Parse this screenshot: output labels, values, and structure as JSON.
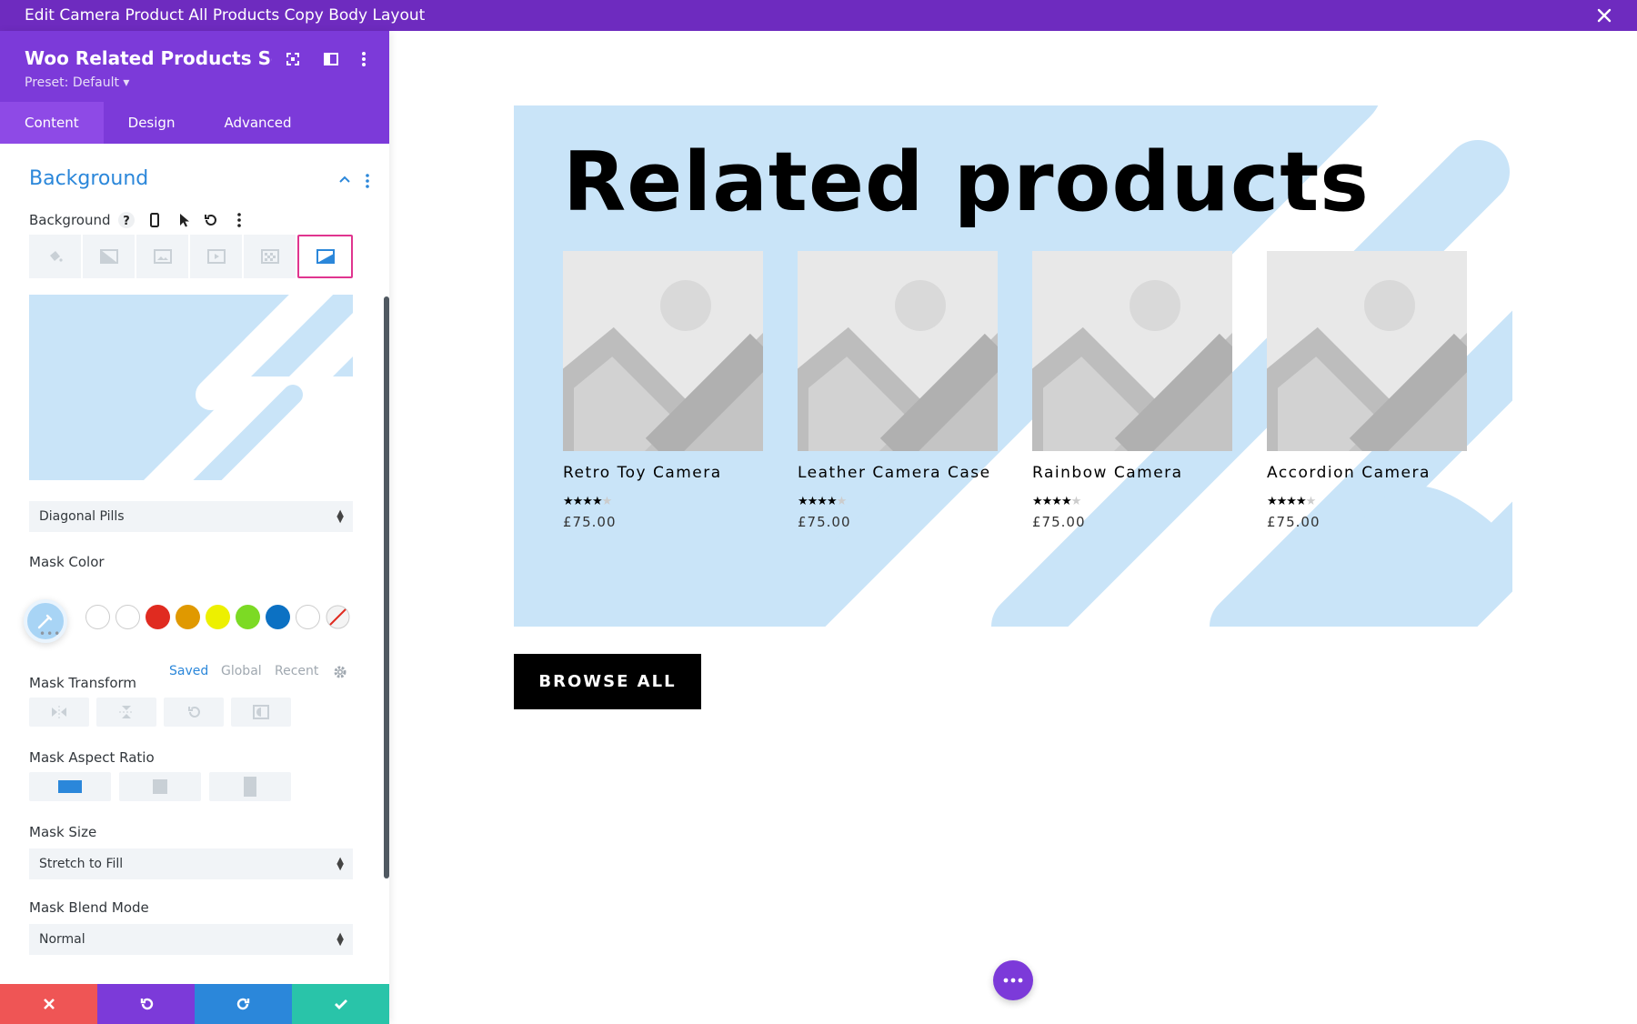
{
  "window": {
    "title": "Edit Camera Product All Products Copy Body Layout"
  },
  "panel": {
    "title": "Woo Related Products Setti...",
    "preset": "Preset: Default ▾",
    "tabs": [
      {
        "label": "Content"
      },
      {
        "label": "Design"
      },
      {
        "label": "Advanced"
      }
    ],
    "section_title": "Background",
    "background_label": "Background",
    "background_tabs": [
      "paint-bucket-icon",
      "gradient-icon",
      "image-icon",
      "video-icon",
      "pattern-icon",
      "mask-icon"
    ],
    "active_background_tab": "mask-icon",
    "mask_style": {
      "value": "Diagonal Pills"
    },
    "mask_color": {
      "label": "Mask Color",
      "swatches": [
        "#ffffff",
        "#ffffff",
        "#e02b20",
        "#e09900",
        "#edf000",
        "#7cda24",
        "#0c71c3",
        "#ffffff"
      ],
      "tabs": [
        "Saved",
        "Global",
        "Recent"
      ],
      "active_tab": "Saved",
      "more_label": "•••"
    },
    "mask_transform": {
      "label": "Mask Transform"
    },
    "mask_aspect_ratio": {
      "label": "Mask Aspect Ratio"
    },
    "mask_size": {
      "label": "Mask Size",
      "value": "Stretch to Fill"
    },
    "mask_blend_mode": {
      "label": "Mask Blend Mode",
      "value": "Normal"
    }
  },
  "canvas": {
    "heading": "Related products",
    "products": [
      {
        "name": "Retro Toy Camera",
        "price": "£75.00",
        "rating": 4
      },
      {
        "name": "Leather Camera Case",
        "price": "£75.00",
        "rating": 4
      },
      {
        "name": "Rainbow Camera",
        "price": "£75.00",
        "rating": 4
      },
      {
        "name": "Accordion Camera",
        "price": "£75.00",
        "rating": 4
      }
    ],
    "button_label": "BROWSE ALL"
  },
  "colors": {
    "topbar": "#6e2bbf",
    "panel_header": "#7c3ad9",
    "accent_blue": "#2b87da",
    "mask_bg": "#c9e4f8",
    "footer": [
      "#ef5555",
      "#7c3ad9",
      "#2b87da",
      "#29c4a9"
    ]
  }
}
